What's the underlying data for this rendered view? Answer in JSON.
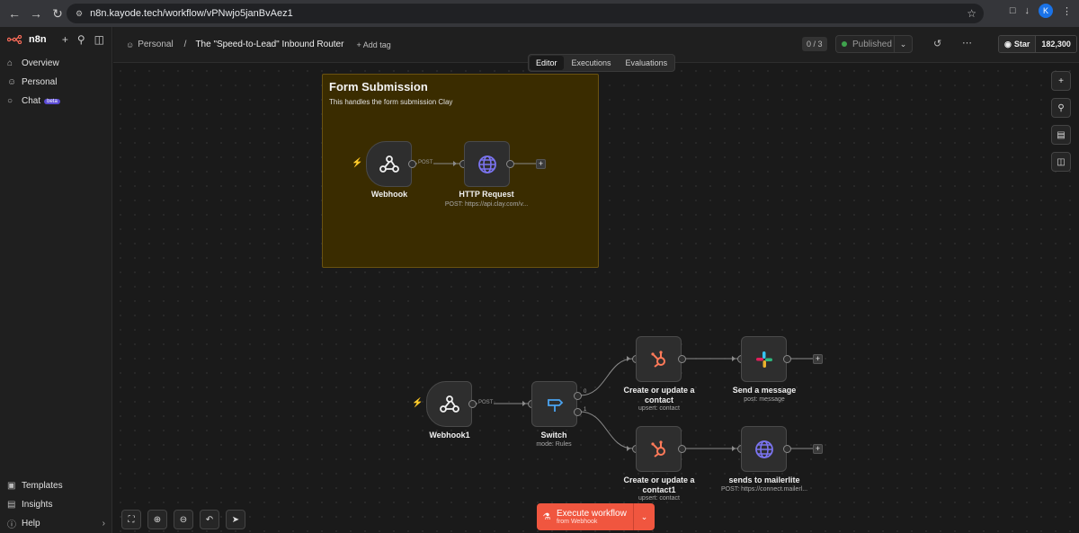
{
  "browser": {
    "url": "n8n.kayode.tech/workflow/vPNwjo5janBvAez1",
    "profile_initial": "K"
  },
  "sidebar": {
    "logo": "n8n",
    "items": [
      {
        "label": "Overview",
        "icon": "home-icon"
      },
      {
        "label": "Personal",
        "icon": "user-icon"
      },
      {
        "label": "Chat",
        "icon": "chat-icon",
        "badge": "beta"
      }
    ],
    "bottom_items": [
      {
        "label": "Templates",
        "icon": "templates-icon"
      },
      {
        "label": "Insights",
        "icon": "insights-icon"
      },
      {
        "label": "Help",
        "icon": "help-icon"
      }
    ]
  },
  "header": {
    "breadcrumb": "Personal",
    "separator": "/",
    "title": "The \"Speed-to-Lead\" Inbound Router",
    "add_tag": "+ Add tag",
    "counter": "0 / 3",
    "status": "Published",
    "github_star": "Star",
    "github_count": "182,300"
  },
  "tabs": [
    {
      "label": "Editor",
      "active": true
    },
    {
      "label": "Executions"
    },
    {
      "label": "Evaluations"
    }
  ],
  "sticky": {
    "title": "Form Submission",
    "text": "This handles the form submission Clay"
  },
  "nodes": {
    "webhook": {
      "label": "Webhook",
      "edge": "POST"
    },
    "http": {
      "label": "HTTP Request",
      "sub": "POST: https://api.clay.com/v..."
    },
    "webhook1": {
      "label": "Webhook1",
      "edge": "POST"
    },
    "switch": {
      "label": "Switch",
      "sub": "mode: Rules",
      "out0": "0",
      "out1": "1"
    },
    "hubspot1": {
      "label": "Create or update a contact",
      "sub": "upsert: contact"
    },
    "hubspot2": {
      "label": "Create or update a contact1",
      "sub": "upsert: contact"
    },
    "slack": {
      "label": "Send a message",
      "sub": "post: message"
    },
    "mailerlite": {
      "label": "sends to mailerlite",
      "sub": "POST: https://connect.mailerl..."
    }
  },
  "execute": {
    "label": "Execute workflow",
    "sub": "from Webhook"
  },
  "colors": {
    "accent": "#f0563f",
    "sticky_bg": "#3a2c00",
    "hubspot": "#ff7a59",
    "globe": "#7b74f0",
    "switch": "#4aa3f0"
  }
}
